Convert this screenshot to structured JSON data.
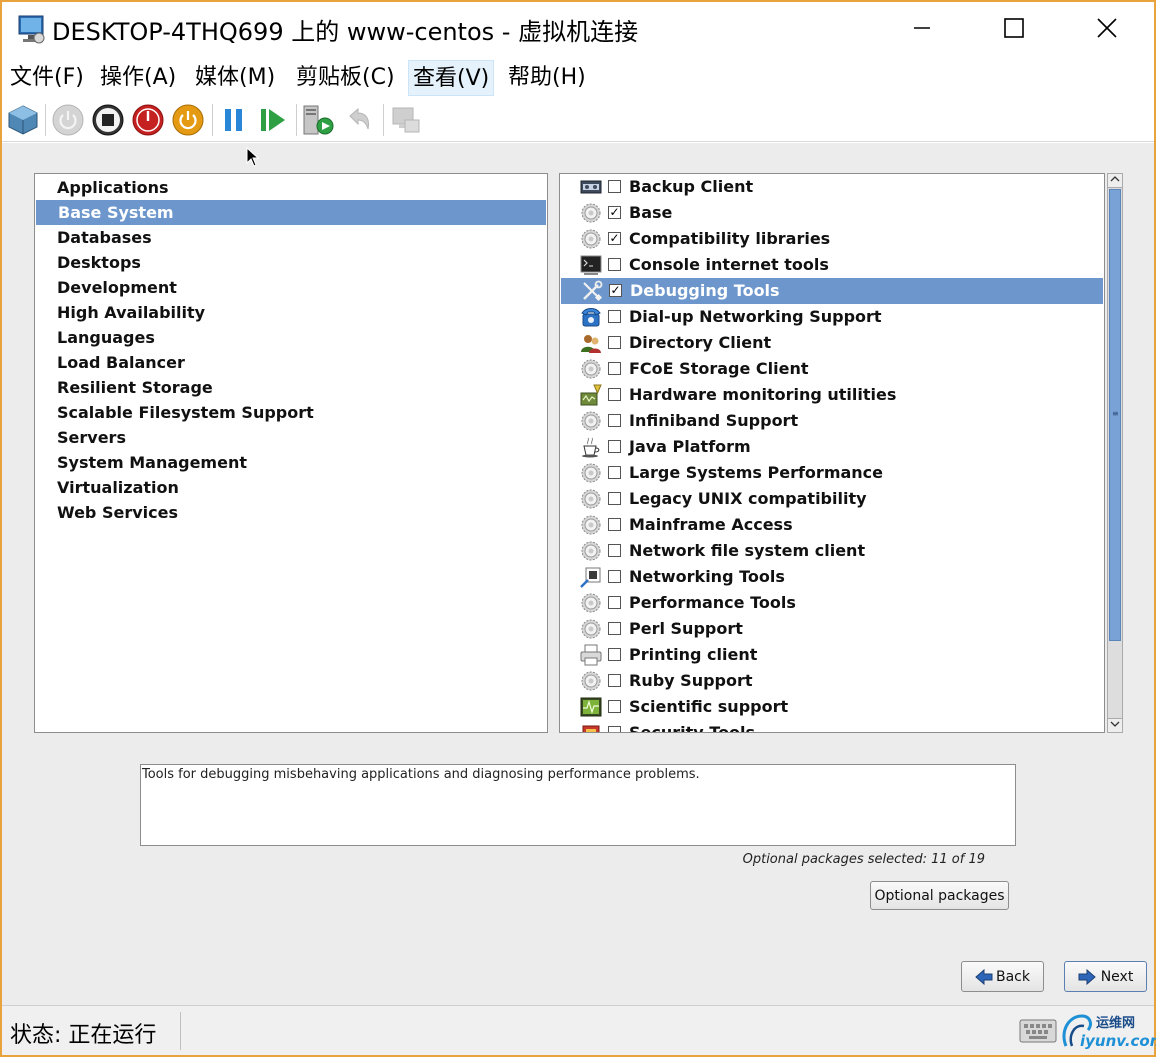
{
  "window": {
    "title": "DESKTOP-4THQ699 上的 www-centos - 虚拟机连接",
    "app_icon": "vm-connection-icon",
    "controls": {
      "minimize": "minimize-icon",
      "maximize": "maximize-icon",
      "close": "close-icon"
    }
  },
  "menu": [
    {
      "label": "文件(F)"
    },
    {
      "label": "操作(A)"
    },
    {
      "label": "媒体(M)"
    },
    {
      "label": "剪贴板(C)"
    },
    {
      "label": "查看(V)",
      "active": true
    },
    {
      "label": "帮助(H)"
    }
  ],
  "toolbar": [
    {
      "name": "ctrl-alt-del-icon"
    },
    {
      "name": "start-icon",
      "disabled": true
    },
    {
      "name": "turn-off-icon"
    },
    {
      "name": "shutdown-icon"
    },
    {
      "name": "save-icon"
    },
    {
      "name": "pause-icon"
    },
    {
      "name": "reset-icon"
    },
    {
      "name": "checkpoint-icon"
    },
    {
      "name": "revert-icon",
      "disabled": true
    },
    {
      "name": "enhanced-session-icon",
      "disabled": true
    }
  ],
  "groups": {
    "selected_index": 1,
    "items": [
      "Applications",
      "Base System",
      "Databases",
      "Desktops",
      "Development",
      "High Availability",
      "Languages",
      "Load Balancer",
      "Resilient Storage",
      "Scalable Filesystem Support",
      "Servers",
      "System Management",
      "Virtualization",
      "Web Services"
    ]
  },
  "packages": {
    "selected_index": 4,
    "items": [
      {
        "label": "Backup Client",
        "checked": false,
        "icon": "backup-tape-icon"
      },
      {
        "label": "Base",
        "checked": true,
        "icon": "gear-icon"
      },
      {
        "label": "Compatibility libraries",
        "checked": true,
        "icon": "gear-icon"
      },
      {
        "label": "Console internet tools",
        "checked": false,
        "icon": "terminal-icon"
      },
      {
        "label": "Debugging Tools",
        "checked": true,
        "icon": "tools-icon"
      },
      {
        "label": "Dial-up Networking Support",
        "checked": false,
        "icon": "telephone-icon"
      },
      {
        "label": "Directory Client",
        "checked": false,
        "icon": "users-icon"
      },
      {
        "label": "FCoE Storage Client",
        "checked": false,
        "icon": "gear-icon"
      },
      {
        "label": "Hardware monitoring utilities",
        "checked": false,
        "icon": "hardware-monitor-icon"
      },
      {
        "label": "Infiniband Support",
        "checked": false,
        "icon": "gear-icon"
      },
      {
        "label": "Java Platform",
        "checked": false,
        "icon": "coffee-cup-icon"
      },
      {
        "label": "Large Systems Performance",
        "checked": false,
        "icon": "gear-icon"
      },
      {
        "label": "Legacy UNIX compatibility",
        "checked": false,
        "icon": "gear-icon"
      },
      {
        "label": "Mainframe Access",
        "checked": false,
        "icon": "gear-icon"
      },
      {
        "label": "Network file system client",
        "checked": false,
        "icon": "gear-icon"
      },
      {
        "label": "Networking Tools",
        "checked": false,
        "icon": "network-tools-icon"
      },
      {
        "label": "Performance Tools",
        "checked": false,
        "icon": "gear-icon"
      },
      {
        "label": "Perl Support",
        "checked": false,
        "icon": "gear-icon"
      },
      {
        "label": "Printing client",
        "checked": false,
        "icon": "printer-icon"
      },
      {
        "label": "Ruby Support",
        "checked": false,
        "icon": "gear-icon"
      },
      {
        "label": "Scientific support",
        "checked": false,
        "icon": "oscilloscope-icon"
      },
      {
        "label": "Security Tools",
        "checked": false,
        "icon": "security-icon"
      }
    ]
  },
  "description": "Tools for debugging misbehaving applications and diagnosing performance problems.",
  "optional_count": "Optional packages selected: 11 of 19",
  "buttons": {
    "optional": "Optional packages",
    "back": "Back",
    "next": "Next"
  },
  "status": {
    "text": "状态: 正在运行",
    "watermark_top": "运维网",
    "watermark_bottom": "iyunv.com"
  },
  "colors": {
    "frame": "#e8a33d",
    "selection": "#6d97cc",
    "guest_background": "#ececec"
  }
}
